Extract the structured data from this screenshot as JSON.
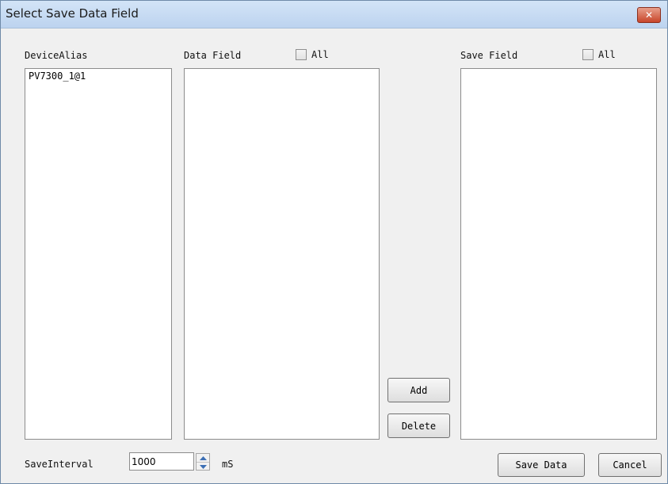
{
  "window": {
    "title": "Select Save Data Field",
    "close_glyph": "✕"
  },
  "device_alias": {
    "label": "DeviceAlias",
    "items": [
      "PV7300_1@1"
    ]
  },
  "data_field": {
    "label": "Data Field",
    "all_label": "All",
    "all_checked": false,
    "items": []
  },
  "save_field": {
    "label": "Save Field",
    "all_label": "All",
    "all_checked": false,
    "items": []
  },
  "buttons": {
    "add": "Add",
    "delete": "Delete",
    "save_data": "Save Data",
    "cancel": "Cancel"
  },
  "save_interval": {
    "label": "SaveInterval",
    "value": "1000",
    "unit": "mS"
  },
  "colors": {
    "title_bar": "#c9dcf3",
    "close_button": "#c8452a",
    "dialog_bg": "#f0f0f0"
  }
}
